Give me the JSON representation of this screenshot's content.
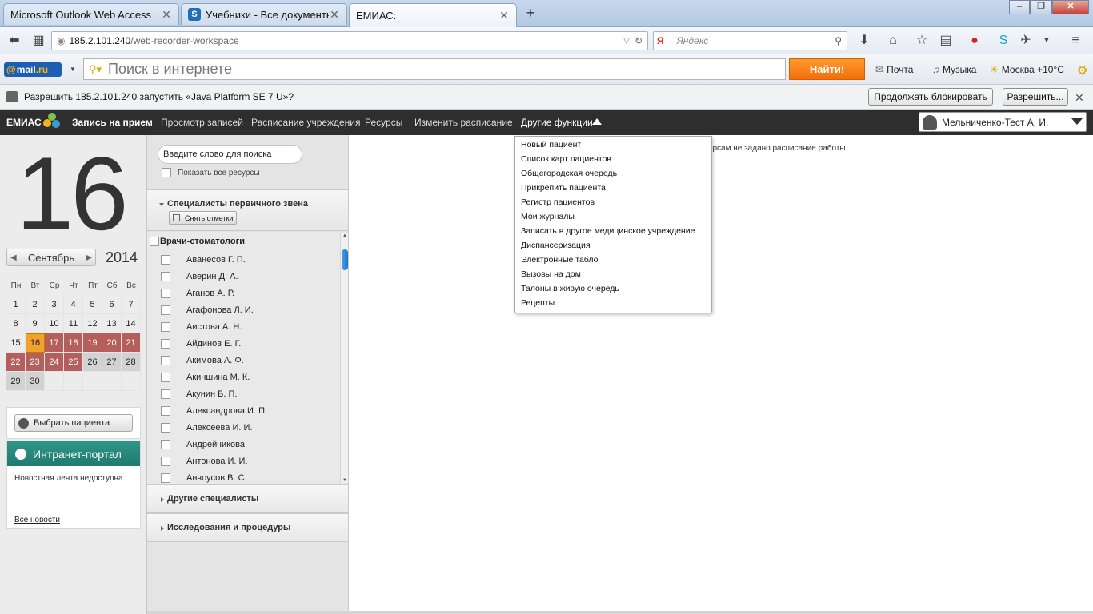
{
  "browser": {
    "tabs": [
      {
        "title": "Microsoft Outlook Web Access",
        "active": false
      },
      {
        "title": "Учебники - Все документы",
        "active": false
      },
      {
        "title": "ЕМИАС:",
        "active": true
      }
    ],
    "url_host": "185.2.101.240",
    "url_path": "/web-recorder-workspace",
    "search_placeholder": "Яндекс",
    "search_engine_badge": "Я"
  },
  "mailru": {
    "logo_at": "@",
    "logo_text": "mail",
    "logo_ru": ".ru",
    "search_placeholder": "Поиск в интернете",
    "find_button": "Найти!",
    "links": {
      "mail": "Почта",
      "music": "Музыка",
      "weather": "Москва +10°C"
    }
  },
  "infobar": {
    "message": "Разрешить 185.2.101.240 запустить «Java Platform SE 7 U»?",
    "continue_block": "Продолжать блокировать",
    "allow": "Разрешить..."
  },
  "app": {
    "logo": "ЕМИАС",
    "menu": [
      "Запись на прием",
      "Просмотр записей",
      "Расписание учреждения",
      "Ресурсы",
      "Изменить расписание",
      "Другие функции"
    ],
    "user": "Мельниченко-Тест А. И."
  },
  "calendar": {
    "big_day": "16",
    "month": "Сентябрь",
    "year": "2014",
    "weekdays": [
      "Пн",
      "Вт",
      "Ср",
      "Чт",
      "Пт",
      "Сб",
      "Вс"
    ],
    "weeks": [
      [
        "1",
        "2",
        "3",
        "4",
        "5",
        "6",
        "7"
      ],
      [
        "8",
        "9",
        "10",
        "11",
        "12",
        "13",
        "14"
      ],
      [
        "15",
        "16",
        "17",
        "18",
        "19",
        "20",
        "21"
      ],
      [
        "22",
        "23",
        "24",
        "25",
        "26",
        "27",
        "28"
      ],
      [
        "29",
        "30",
        "",
        "",
        "",
        "",
        ""
      ]
    ]
  },
  "left_panel": {
    "select_patient": "Выбрать пациента",
    "intranet_title": "Интранет-портал",
    "intranet_message": "Новостная лента недоступна.",
    "all_news": "Все новости"
  },
  "resources": {
    "search_placeholder": "Введите слово для поиска",
    "show_all": "Показать все ресурсы",
    "section_primary": "Специалисты первичного звена",
    "clear_marks": "Снять отметки",
    "group": "Врачи-стоматологи",
    "doctors": [
      "Аванесов Г. П.",
      "Аверин Д. А.",
      "Аганов А. Р.",
      "Агафонова Л. И.",
      "Аистова А. Н.",
      "Айдинов Е. Г.",
      "Акимова А. Ф.",
      "Акиншина М. К.",
      "Акунин Б. П.",
      "Александрова И. П.",
      "Алексеева И. И.",
      "Андрейчикова",
      "Антонова И. И.",
      "Анчоусов В. С."
    ],
    "section_other": "Другие специалисты",
    "section_research": "Исследования и процедуры"
  },
  "main": {
    "message": "есурсам не задано расписание работы."
  },
  "dropdown": {
    "items": [
      "Новый пациент",
      "Список карт пациентов",
      "Общегородская очередь",
      "Прикрепить пациента",
      "Регистр пациентов",
      "Мои журналы",
      "Записать в другое медицинское учреждение",
      "Диспансеризация",
      "Электронные табло",
      "Вызовы на дом",
      "Талоны в живую очередь",
      "Рецепты"
    ]
  },
  "colors": {
    "appbar": "#2e2e2e",
    "booked_red": "#b45f5b",
    "today_orange": "#f2a22a",
    "intranet_teal": "#1f7a6f",
    "find_orange": "#f26e0b"
  }
}
